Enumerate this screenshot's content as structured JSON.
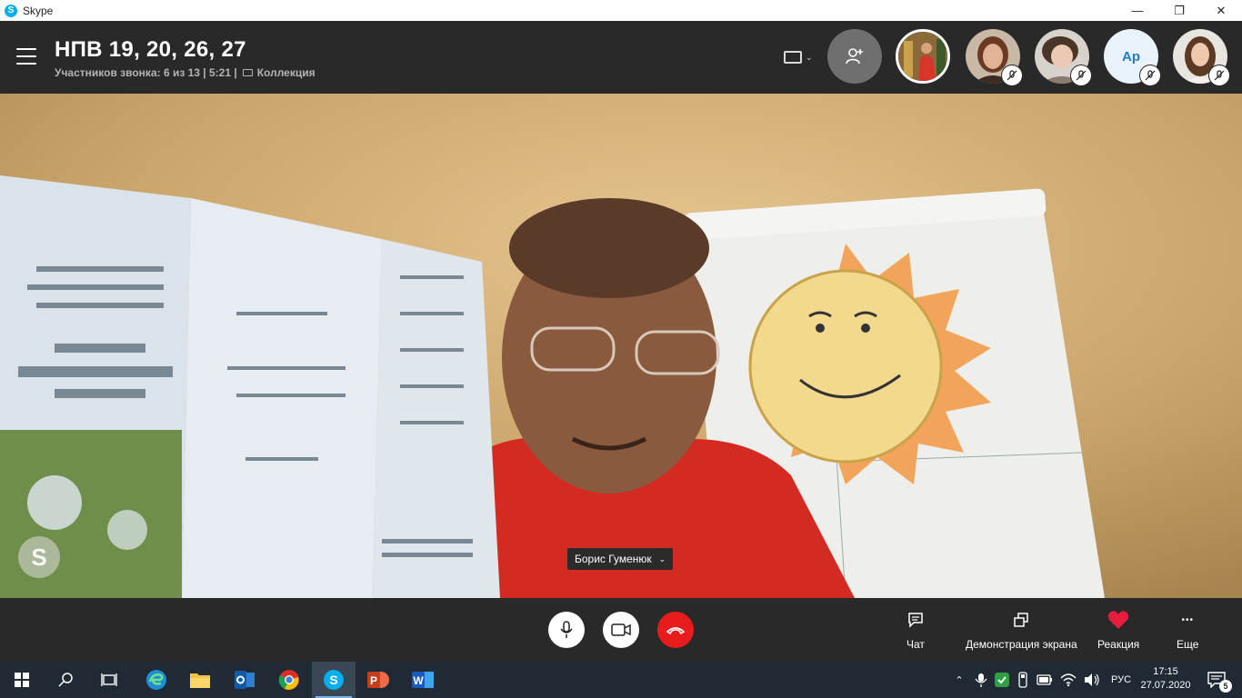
{
  "window": {
    "app_name": "Skype",
    "minimize_icon": "—",
    "maximize_icon": "❐",
    "close_icon": "✕"
  },
  "call": {
    "title": "НПВ 19, 20, 26, 27",
    "participants_text": "Участников звонка: 6 из 13 | 5:21 |",
    "gallery_label": "Коллекция",
    "avatar_initials": "Ар"
  },
  "video": {
    "speaker_name": "Борис Гуменюк",
    "watermark": "S"
  },
  "controls": {
    "chat_label": "Чат",
    "screen_share_label": "Демонстрация экрана",
    "reaction_label": "Реакция",
    "more_label": "Еще",
    "more_icon": "•••"
  },
  "taskbar": {
    "language": "РУС",
    "time": "17:15",
    "date": "27.07.2020",
    "notification_count": "5"
  },
  "colors": {
    "dark_bg": "#292929",
    "end_call": "#e81c1c",
    "skype_blue": "#00aff0",
    "reaction_heart": "#e81c3c"
  }
}
